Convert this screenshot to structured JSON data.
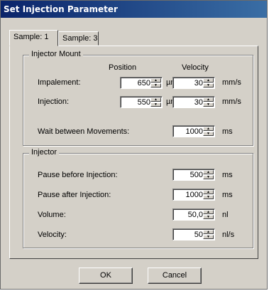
{
  "window": {
    "title": "Set Injection Parameter"
  },
  "tabs": [
    {
      "label": "Sample: 1",
      "active": true
    },
    {
      "label": "Sample: 3",
      "active": false
    }
  ],
  "injector_mount": {
    "title": "Injector Mount",
    "col_position": "Position",
    "col_velocity": "Velocity",
    "impalement": {
      "label": "Impalement:",
      "position": "650",
      "position_unit": "µm",
      "velocity": "30",
      "velocity_unit": "mm/s"
    },
    "injection": {
      "label": "Injection:",
      "position": "550",
      "position_unit": "µm",
      "velocity": "30",
      "velocity_unit": "mm/s"
    },
    "wait": {
      "label": "Wait between Movements:",
      "value": "1000",
      "unit": "ms"
    }
  },
  "injector": {
    "title": "Injector",
    "pause_before": {
      "label": "Pause before Injection:",
      "value": "500",
      "unit": "ms"
    },
    "pause_after": {
      "label": "Pause after Injection:",
      "value": "1000",
      "unit": "ms"
    },
    "volume": {
      "label": "Volume:",
      "value": "50,0",
      "unit": "nl"
    },
    "velocity": {
      "label": "Velocity:",
      "value": "50",
      "unit": "nl/s"
    }
  },
  "buttons": {
    "ok": "OK",
    "cancel": "Cancel"
  },
  "icons": {
    "spin_up": "spin-up-arrow-icon",
    "spin_down": "spin-down-arrow-icon"
  }
}
